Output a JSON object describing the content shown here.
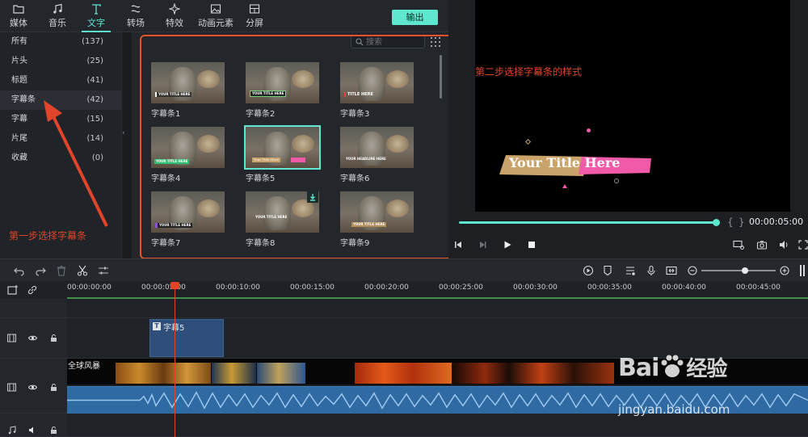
{
  "toolbar": {
    "tabs": [
      {
        "label": "媒体",
        "icon": "folder-icon"
      },
      {
        "label": "音乐",
        "icon": "music-note-icon"
      },
      {
        "label": "文字",
        "icon": "text-icon"
      },
      {
        "label": "转场",
        "icon": "transition-icon"
      },
      {
        "label": "特效",
        "icon": "sparkle-icon"
      },
      {
        "label": "动画元素",
        "icon": "image-icon"
      },
      {
        "label": "分屏",
        "icon": "split-screen-icon"
      }
    ],
    "active_tab": "文字",
    "export_label": "输出"
  },
  "categories": [
    {
      "label": "所有",
      "count": "(137)"
    },
    {
      "label": "片头",
      "count": "(25)"
    },
    {
      "label": "标题",
      "count": "(41)"
    },
    {
      "label": "字幕条",
      "count": "(42)"
    },
    {
      "label": "字幕",
      "count": "(15)"
    },
    {
      "label": "片尾",
      "count": "(14)"
    },
    {
      "label": "收藏",
      "count": "(0)"
    }
  ],
  "selected_category": "字幕条",
  "search": {
    "placeholder": "搜索"
  },
  "thumbnails": [
    {
      "label": "字幕条1",
      "caption": "YOUR TITLE HERE"
    },
    {
      "label": "字幕条2",
      "caption": "YOUR TITLE HERE"
    },
    {
      "label": "字幕条3",
      "caption": "TITLE HERE"
    },
    {
      "label": "字幕条4",
      "caption": "YOUR TITLE HERE"
    },
    {
      "label": "字幕条5",
      "caption": "Your Title Here"
    },
    {
      "label": "字幕条6",
      "caption": "YOUR HEADLINE HERE"
    },
    {
      "label": "字幕条7",
      "caption": "YOUR TITLE HERE"
    },
    {
      "label": "字幕条8",
      "caption": "YOUR TITLE HERE"
    },
    {
      "label": "字幕条9",
      "caption": "YOUR TITLE HERE"
    }
  ],
  "selected_thumbnail": "字幕条5",
  "annotations": {
    "step1": "第一步选择字幕条",
    "step2": "第二步选择字幕条的样式"
  },
  "preview": {
    "title_text": "Your Title Here",
    "timecode": "00:00:05:00",
    "progress": 1.0
  },
  "timeline": {
    "ruler_ticks": [
      "00:00:00:00",
      "00:00:05:00",
      "00:00:10:00",
      "00:00:15:00",
      "00:00:20:00",
      "00:00:25:00",
      "00:00:30:00",
      "00:00:35:00",
      "00:00:40:00",
      "00:00:45:00"
    ],
    "title_clip_label": "字幕5",
    "video_clip_label": "全球风暴",
    "zoom_level": 0.55
  },
  "watermark": {
    "brand": "Bai",
    "brand_cn": "经验",
    "url": "jingyan.baidu.com"
  },
  "colors": {
    "accent": "#5ee6cf",
    "annotation": "#e0442a",
    "title_clip": "#2f4e79",
    "audio": "#2f6aa3"
  }
}
